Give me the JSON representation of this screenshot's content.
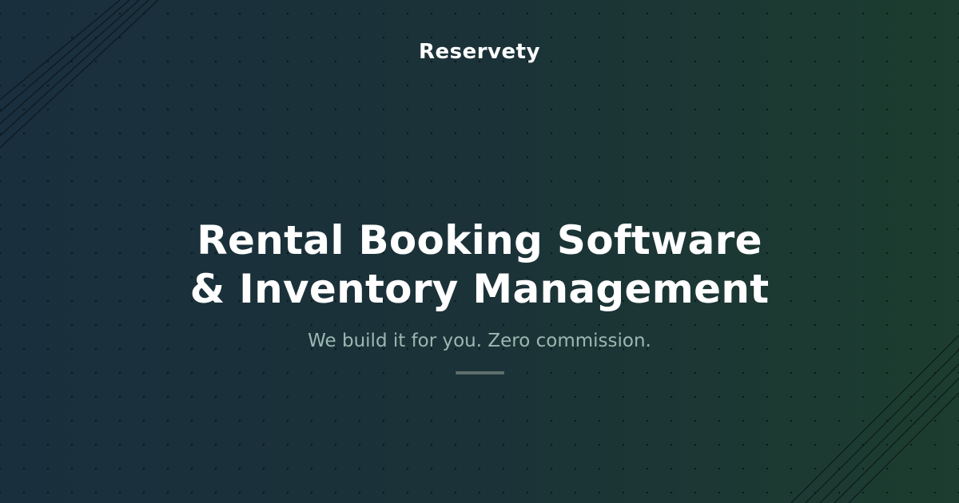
{
  "brand": {
    "name": "Reservety"
  },
  "hero": {
    "headline_line1": "Rental Booking Software",
    "headline_line2": "& Inventory Management",
    "tagline": "We build it for you. Zero commission."
  },
  "colors": {
    "background_start": "#1a2f3d",
    "background_end": "#1c3d2f",
    "headline": "#ffffff",
    "tagline": "#9bb8b1",
    "divider": "#5d6e6c"
  }
}
